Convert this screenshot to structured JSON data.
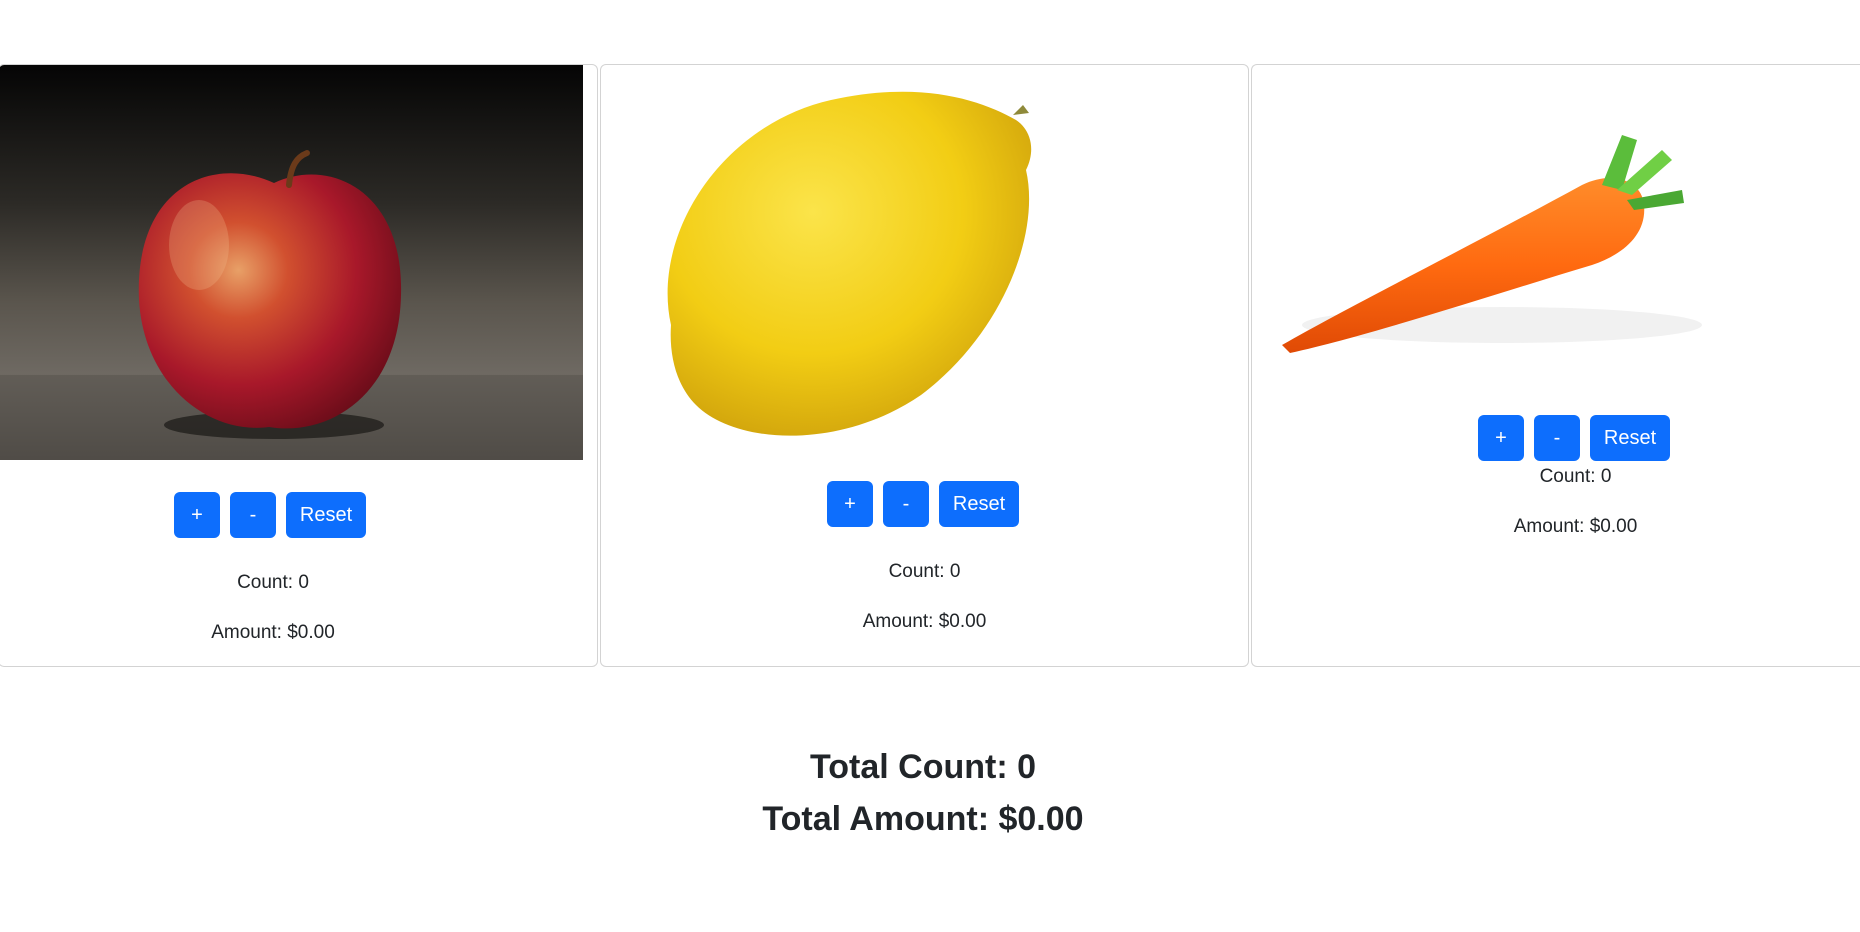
{
  "products": [
    {
      "name": "apple",
      "plus_label": "+",
      "minus_label": "-",
      "reset_label": "Reset",
      "count_text": "Count: 0",
      "amount_text": "Amount: $0.00"
    },
    {
      "name": "lemon",
      "plus_label": "+",
      "minus_label": "-",
      "reset_label": "Reset",
      "count_text": "Count: 0",
      "amount_text": "Amount: $0.00"
    },
    {
      "name": "carrot",
      "plus_label": "+",
      "minus_label": "-",
      "reset_label": "Reset",
      "count_text": "Count: 0",
      "amount_text": "Amount: $0.00"
    }
  ],
  "totals": {
    "count_text": "Total Count: 0",
    "amount_text": "Total Amount: $0.00"
  },
  "colors": {
    "button": "#0d6efd",
    "text": "#212529",
    "card_border": "#d3d3d3"
  },
  "icons": [
    "apple-image",
    "lemon-image",
    "carrot-image"
  ]
}
